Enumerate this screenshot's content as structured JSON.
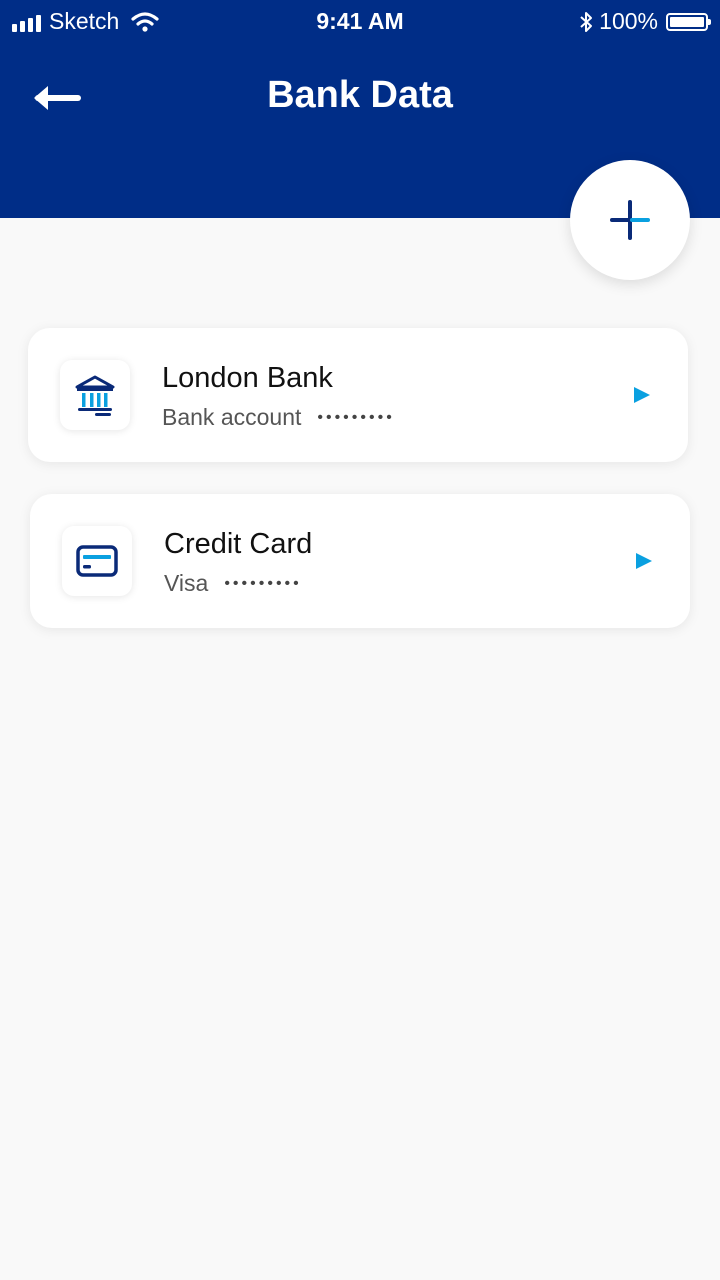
{
  "status_bar": {
    "carrier": "Sketch",
    "time": "9:41 AM",
    "battery": "100%"
  },
  "header": {
    "title": "Bank Data"
  },
  "accounts": [
    {
      "title": "London Bank",
      "type": "Bank account",
      "masked": "•••••••••",
      "icon": "bank-icon"
    },
    {
      "title": "Credit Card",
      "type": "Visa",
      "masked": "•••••••••",
      "icon": "credit-card-icon"
    }
  ],
  "colors": {
    "header_bg": "#002d87",
    "accent": "#0aa0e0",
    "icon_dark": "#0a2a78"
  }
}
